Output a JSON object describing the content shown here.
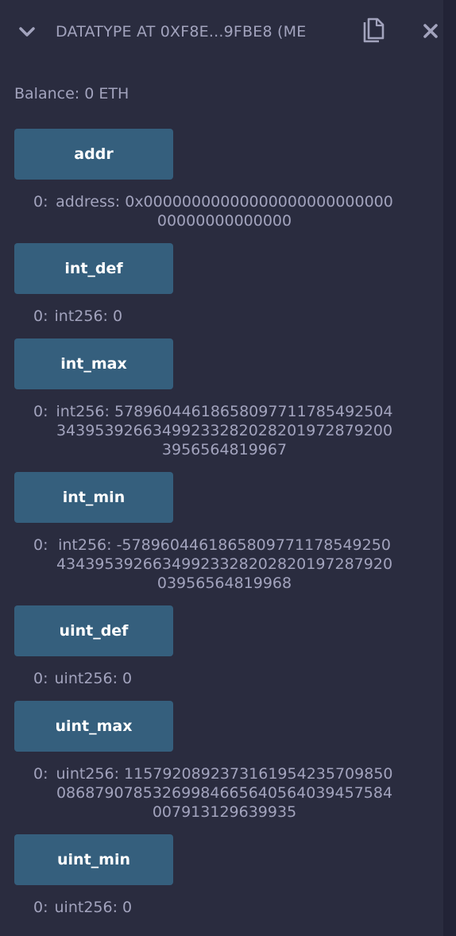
{
  "header": {
    "title": "DATATYPE AT 0XF8E...9FBE8 (ME",
    "expand_icon": "chevron-down-icon",
    "copy_icon": "copy-icon",
    "close_icon": "close-icon"
  },
  "balance": "Balance: 0 ETH",
  "functions": [
    {
      "label": "addr",
      "result_index": "0:",
      "result_value": "address: 0x0000000000000000000000000000000000000000"
    },
    {
      "label": "int_def",
      "result_index": "0:",
      "result_value": "int256: 0"
    },
    {
      "label": "int_max",
      "result_index": "0:",
      "result_value": "int256: 57896044618658097711785492504343953926634992332820282019728792003956564819967"
    },
    {
      "label": "int_min",
      "result_index": "0:",
      "result_value": "int256: -57896044618658097711785492504343953926634992332820282019728792003956564819968"
    },
    {
      "label": "uint_def",
      "result_index": "0:",
      "result_value": "uint256: 0"
    },
    {
      "label": "uint_max",
      "result_index": "0:",
      "result_value": "uint256: 115792089237316195423570985008687907853269984665640564039457584007913129639935"
    },
    {
      "label": "uint_min",
      "result_index": "0:",
      "result_value": "uint256: 0"
    }
  ],
  "colors": {
    "background": "#2a2c3f",
    "button": "#355f7d",
    "text": "#a2a3bd"
  }
}
